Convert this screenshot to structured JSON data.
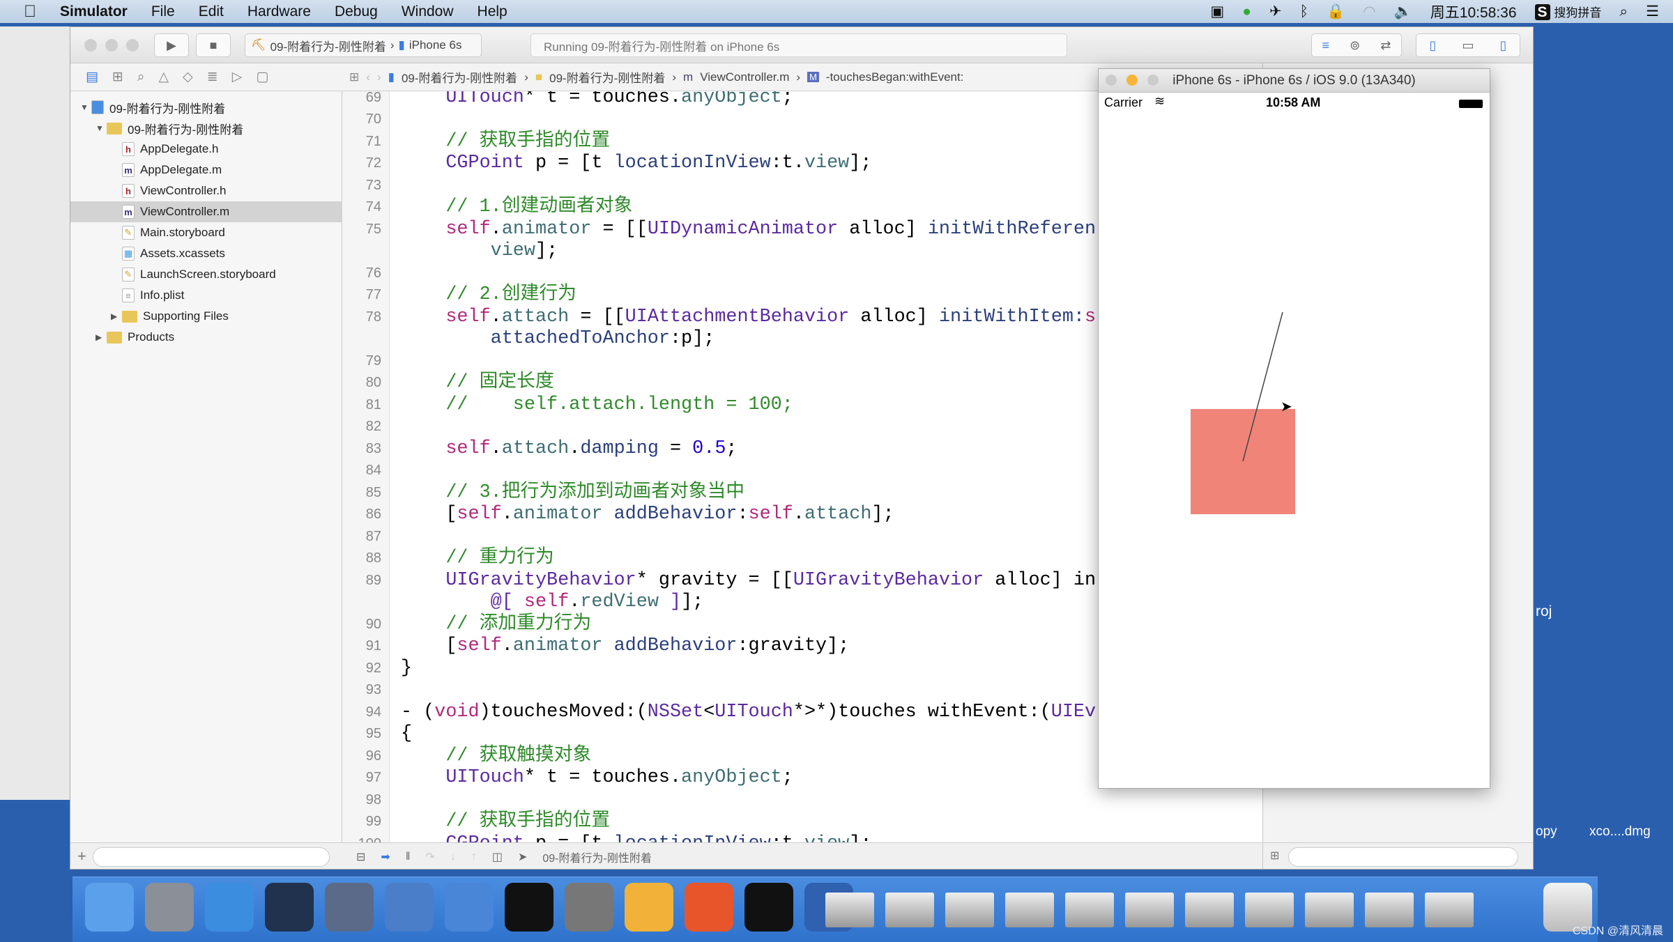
{
  "menubar": {
    "items": [
      "Simulator",
      "File",
      "Edit",
      "Hardware",
      "Debug",
      "Window",
      "Help"
    ],
    "clock": "周五10:58:36",
    "ime": "搜狗拼音"
  },
  "toolbar": {
    "scheme": "09-附着行为-刚性附着",
    "device": "iPhone 6s",
    "status": "Running 09-附着行为-刚性附着 on iPhone 6s"
  },
  "jumpbar": [
    "09-附着行为-刚性附着",
    "09-附着行为-刚性附着",
    "ViewController.m",
    "-touchesBegan:withEvent:"
  ],
  "navigator": {
    "items": [
      {
        "label": "09-附着行为-刚性附着",
        "depth": 0,
        "kind": "project",
        "disclosure": "open"
      },
      {
        "label": "09-附着行为-刚性附着",
        "depth": 1,
        "kind": "folder",
        "disclosure": "open"
      },
      {
        "label": "AppDelegate.h",
        "depth": 2,
        "kind": "h"
      },
      {
        "label": "AppDelegate.m",
        "depth": 2,
        "kind": "m"
      },
      {
        "label": "ViewController.h",
        "depth": 2,
        "kind": "h"
      },
      {
        "label": "ViewController.m",
        "depth": 2,
        "kind": "m",
        "selected": true
      },
      {
        "label": "Main.storyboard",
        "depth": 2,
        "kind": "sb"
      },
      {
        "label": "Assets.xcassets",
        "depth": 2,
        "kind": "assets"
      },
      {
        "label": "LaunchScreen.storyboard",
        "depth": 2,
        "kind": "sb"
      },
      {
        "label": "Info.plist",
        "depth": 2,
        "kind": "plist"
      },
      {
        "label": "Supporting Files",
        "depth": 2,
        "kind": "folder",
        "disclosure": "closed"
      },
      {
        "label": "Products",
        "depth": 1,
        "kind": "folder",
        "disclosure": "closed"
      }
    ]
  },
  "code": [
    {
      "n": "69",
      "s": [
        [
          "t",
          "    UITouch"
        ],
        [
          "",
          "* t = touches."
        ],
        [
          "p",
          "anyObject"
        ],
        [
          "",
          ";"
        ]
      ]
    },
    {
      "n": "70",
      "s": []
    },
    {
      "n": "71",
      "s": [
        [
          "c",
          "    // 获取手指的位置"
        ]
      ]
    },
    {
      "n": "72",
      "s": [
        [
          "t",
          "    CGPoint"
        ],
        [
          "",
          " p = [t "
        ],
        [
          "m",
          "locationInView"
        ],
        [
          "",
          ":t."
        ],
        [
          "p",
          "view"
        ],
        [
          "",
          "];"
        ]
      ]
    },
    {
      "n": "73",
      "s": []
    },
    {
      "n": "74",
      "s": [
        [
          "c",
          "    // 1.创建动画者对象"
        ]
      ]
    },
    {
      "n": "75",
      "s": [
        [
          "k",
          "    self"
        ],
        [
          "",
          "."
        ],
        [
          "p",
          "animator"
        ],
        [
          "",
          " = [["
        ],
        [
          "t",
          "UIDynamicAnimator"
        ],
        [
          "",
          " alloc] "
        ],
        [
          "m",
          "initWithReferen"
        ]
      ]
    },
    {
      "n": "",
      "s": [
        [
          "p",
          "        view"
        ],
        [
          "",
          "];"
        ]
      ]
    },
    {
      "n": "76",
      "s": []
    },
    {
      "n": "77",
      "s": [
        [
          "c",
          "    // 2.创建行为"
        ]
      ]
    },
    {
      "n": "78",
      "s": [
        [
          "k",
          "    self"
        ],
        [
          "",
          "."
        ],
        [
          "p",
          "attach"
        ],
        [
          "",
          " = [["
        ],
        [
          "t",
          "UIAttachmentBehavior"
        ],
        [
          "",
          " alloc] "
        ],
        [
          "m",
          "initWithItem:"
        ],
        [
          "k",
          "s"
        ]
      ]
    },
    {
      "n": "",
      "s": [
        [
          "m",
          "        attachedToAnchor"
        ],
        [
          "",
          ":p];"
        ]
      ]
    },
    {
      "n": "79",
      "s": []
    },
    {
      "n": "80",
      "s": [
        [
          "c",
          "    // 固定长度"
        ]
      ]
    },
    {
      "n": "81",
      "s": [
        [
          "c",
          "    //    self.attach.length = 100;"
        ]
      ]
    },
    {
      "n": "82",
      "s": []
    },
    {
      "n": "83",
      "s": [
        [
          "k",
          "    self"
        ],
        [
          "",
          "."
        ],
        [
          "p",
          "attach"
        ],
        [
          "",
          "."
        ],
        [
          "m",
          "damping"
        ],
        [
          "",
          " = "
        ],
        [
          "n",
          "0.5"
        ],
        [
          "",
          ";"
        ]
      ]
    },
    {
      "n": "84",
      "s": []
    },
    {
      "n": "85",
      "s": [
        [
          "c",
          "    // 3.把行为添加到动画者对象当中"
        ]
      ]
    },
    {
      "n": "86",
      "s": [
        [
          "",
          "    ["
        ],
        [
          "k",
          "self"
        ],
        [
          "",
          "."
        ],
        [
          "p",
          "animator"
        ],
        [
          "",
          " "
        ],
        [
          "m",
          "addBehavior"
        ],
        [
          "",
          ":"
        ],
        [
          "k",
          "self"
        ],
        [
          "",
          "."
        ],
        [
          "p",
          "attach"
        ],
        [
          "",
          "];"
        ]
      ]
    },
    {
      "n": "87",
      "s": []
    },
    {
      "n": "88",
      "s": [
        [
          "c",
          "    // 重力行为"
        ]
      ]
    },
    {
      "n": "89",
      "s": [
        [
          "t",
          "    UIGravityBehavior"
        ],
        [
          "",
          "* gravity = [["
        ],
        [
          "t",
          "UIGravityBehavior"
        ],
        [
          "",
          " alloc] in"
        ]
      ]
    },
    {
      "n": "",
      "s": [
        [
          "t",
          "        @["
        ],
        [
          "",
          " "
        ],
        [
          "k",
          "self"
        ],
        [
          "",
          "."
        ],
        [
          "p",
          "redView"
        ],
        [
          "t",
          " ]"
        ],
        [
          "",
          "];"
        ]
      ]
    },
    {
      "n": "90",
      "s": [
        [
          "c",
          "    // 添加重力行为"
        ]
      ]
    },
    {
      "n": "91",
      "s": [
        [
          "",
          "    ["
        ],
        [
          "k",
          "self"
        ],
        [
          "",
          "."
        ],
        [
          "p",
          "animator"
        ],
        [
          "",
          " "
        ],
        [
          "m",
          "addBehavior"
        ],
        [
          "",
          ":gravity];"
        ]
      ]
    },
    {
      "n": "92",
      "s": [
        [
          "",
          "}"
        ]
      ]
    },
    {
      "n": "93",
      "s": []
    },
    {
      "n": "94",
      "s": [
        [
          "",
          "- ("
        ],
        [
          "k",
          "void"
        ],
        [
          "",
          ")touchesMoved:("
        ],
        [
          "t",
          "NSSet"
        ],
        [
          "",
          "<"
        ],
        [
          "t",
          "UITouch"
        ],
        [
          "",
          "*>*)touches withEvent:("
        ],
        [
          "t",
          "UIEv"
        ]
      ]
    },
    {
      "n": "95",
      "s": [
        [
          "",
          "{"
        ]
      ]
    },
    {
      "n": "96",
      "s": [
        [
          "c",
          "    // 获取触摸对象"
        ]
      ]
    },
    {
      "n": "97",
      "s": [
        [
          "t",
          "    UITouch"
        ],
        [
          "",
          "* t = touches."
        ],
        [
          "p",
          "anyObject"
        ],
        [
          "",
          ";"
        ]
      ]
    },
    {
      "n": "98",
      "s": []
    },
    {
      "n": "99",
      "s": [
        [
          "c",
          "    // 获取手指的位置"
        ]
      ]
    },
    {
      "n": "100",
      "s": [
        [
          "t",
          "    CGPoint"
        ],
        [
          "",
          " p = [t "
        ],
        [
          "m",
          "locationInView"
        ],
        [
          "",
          ":t."
        ],
        [
          "p",
          "view"
        ],
        [
          "",
          "];"
        ]
      ]
    }
  ],
  "debugbar": {
    "target": "09-附着行为-刚性附着"
  },
  "simulator": {
    "title": "iPhone 6s - iPhone 6s / iOS 9.0 (13A340)",
    "carrier": "Carrier",
    "time": "10:58 AM",
    "red_view_color": "#f08478"
  },
  "desktop": {
    "labels": [
      "roj",
      "opy",
      "xco....dmg"
    ],
    "watermark": "CSDN @清风清晨"
  },
  "dock": {
    "apps": [
      "finder-icon",
      "launchpad-icon",
      "safari-icon",
      "mouse-app-icon",
      "photo-slideshow-icon",
      "xcode-icon",
      "instruments-icon",
      "terminal-icon",
      "system-preferences-icon",
      "sketch-icon",
      "powerpoint-icon",
      "console-icon",
      "quicktime-icon",
      "download-1",
      "download-2",
      "download-3",
      "download-4",
      "download-5",
      "download-6",
      "download-7",
      "download-8",
      "download-9",
      "download-10",
      "download-11",
      "trash-icon"
    ]
  }
}
